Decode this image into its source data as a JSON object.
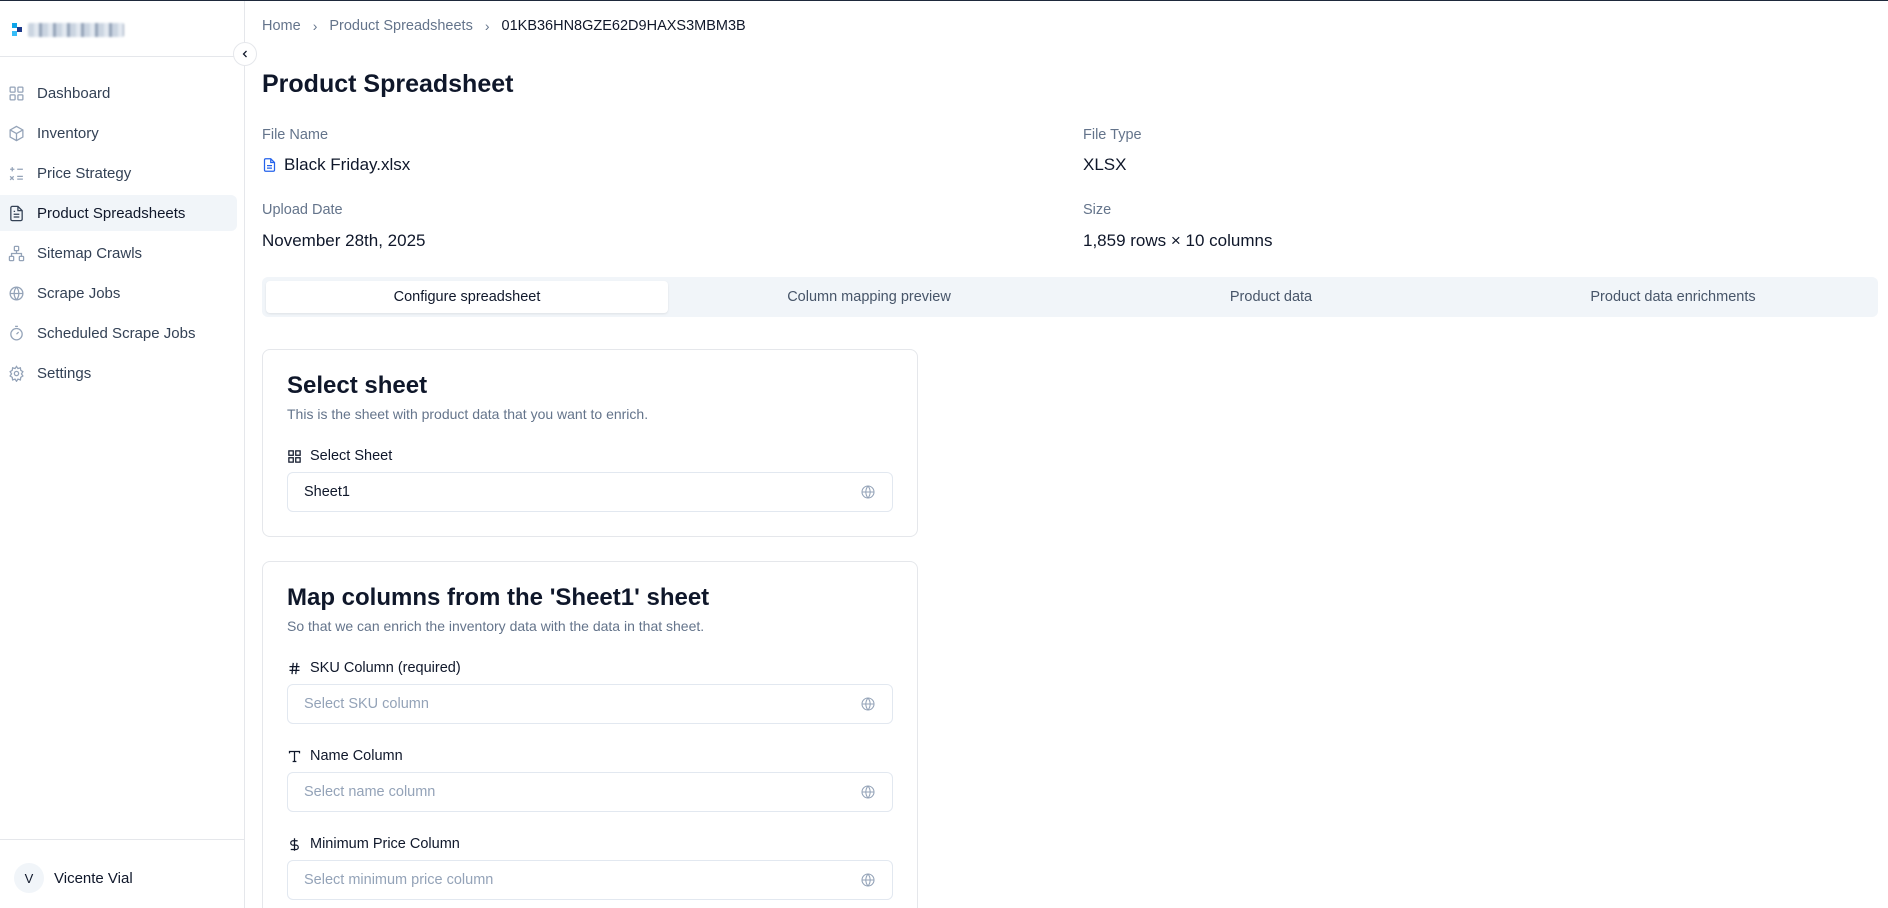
{
  "sidebar": {
    "items": [
      {
        "label": "Dashboard",
        "icon": "dashboard-grid-icon",
        "active": false
      },
      {
        "label": "Inventory",
        "icon": "package-icon",
        "active": false
      },
      {
        "label": "Price Strategy",
        "icon": "strategy-list-icon",
        "active": false
      },
      {
        "label": "Product Spreadsheets",
        "icon": "file-text-icon",
        "active": true
      },
      {
        "label": "Sitemap Crawls",
        "icon": "sitemap-icon",
        "active": false
      },
      {
        "label": "Scrape Jobs",
        "icon": "globe-icon",
        "active": false
      },
      {
        "label": "Scheduled Scrape Jobs",
        "icon": "timer-icon",
        "active": false
      },
      {
        "label": "Settings",
        "icon": "gear-icon",
        "active": false
      }
    ],
    "user": {
      "initial": "V",
      "name": "Vicente Vial"
    }
  },
  "breadcrumb": {
    "home": "Home",
    "section": "Product Spreadsheets",
    "current": "01KB36HN8GZE62D9HAXS3MBM3B"
  },
  "page": {
    "title": "Product Spreadsheet"
  },
  "meta": {
    "file_name_label": "File Name",
    "file_name": "Black Friday.xlsx",
    "file_type_label": "File Type",
    "file_type": "XLSX",
    "upload_date_label": "Upload Date",
    "upload_date": "November 28th, 2025",
    "size_label": "Size",
    "size": "1,859 rows × 10 columns"
  },
  "tabs": [
    {
      "label": "Configure spreadsheet",
      "active": true
    },
    {
      "label": "Column mapping preview",
      "active": false
    },
    {
      "label": "Product data",
      "active": false
    },
    {
      "label": "Product data enrichments",
      "active": false
    }
  ],
  "select_sheet": {
    "title": "Select sheet",
    "description": "This is the sheet with product data that you want to enrich.",
    "label": "Select Sheet",
    "value": "Sheet1"
  },
  "map_columns": {
    "title": "Map columns from the 'Sheet1' sheet",
    "description": "So that we can enrich the inventory data with the data in that sheet.",
    "sku_label": "SKU Column (required)",
    "sku_placeholder": "Select SKU column",
    "name_label": "Name Column",
    "name_placeholder": "Select name column",
    "min_price_label": "Minimum Price Column",
    "min_price_placeholder": "Select minimum price column"
  },
  "colors": {
    "accent": "#2563eb",
    "active_bg": "#f1f5f9",
    "muted": "#64748b"
  }
}
